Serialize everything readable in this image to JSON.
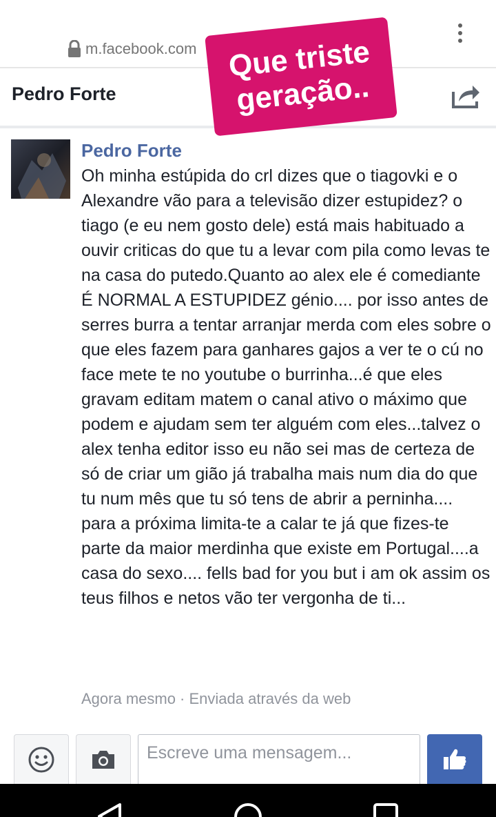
{
  "browser": {
    "url": "m.facebook.com",
    "lock_icon": "lock-icon",
    "menu_icon": "more-vertical-icon"
  },
  "sticker": {
    "line1": "Que triste",
    "line2": "geração..",
    "color": "#d6136d"
  },
  "header": {
    "title": "Pedro Forte",
    "share_icon": "share-icon"
  },
  "message": {
    "sender": "Pedro Forte",
    "text": "Oh minha estúpida do crl dizes que o tiagovki e o Alexandre vão para a televisão dizer estupidez? o tiago (e eu nem gosto dele) está mais habituado a ouvir criticas do que tu a levar com pila como levas te na casa do putedo.Quanto ao alex ele é comediante É NORMAL A ESTUPIDEZ génio.... por isso antes de serres burra a tentar arranjar merda com eles sobre o que eles fazem para ganhares gajos a ver te o cú no face mete te no youtube o burrinha...é que eles gravam editam matem o canal ativo o máximo que podem e ajudam sem ter alguém com eles...talvez o alex tenha editor isso eu não sei mas de certeza de só de criar um gião já trabalha mais num dia do que tu num mês que tu só tens de abrir a perninha.... para a próxima limita-te a calar te já que fizes-te parte da maior merdinha que existe em Portugal....a casa do sexo.... fells bad for you but i am ok assim os teus filhos e netos vão ter vergonha de ti...",
    "meta": "Agora mesmo · Enviada através da web"
  },
  "composer": {
    "placeholder": "Escreve uma mensagem...",
    "emoji_icon": "emoji-icon",
    "camera_icon": "camera-icon",
    "like_icon": "thumbs-up-icon",
    "like_color": "#4267b2"
  },
  "navbar": {
    "back_icon": "back-triangle-icon",
    "home_icon": "home-circle-icon",
    "recents_icon": "recents-square-icon"
  },
  "colors": {
    "sender_name": "#4b67a1",
    "meta_text": "#90949c"
  }
}
